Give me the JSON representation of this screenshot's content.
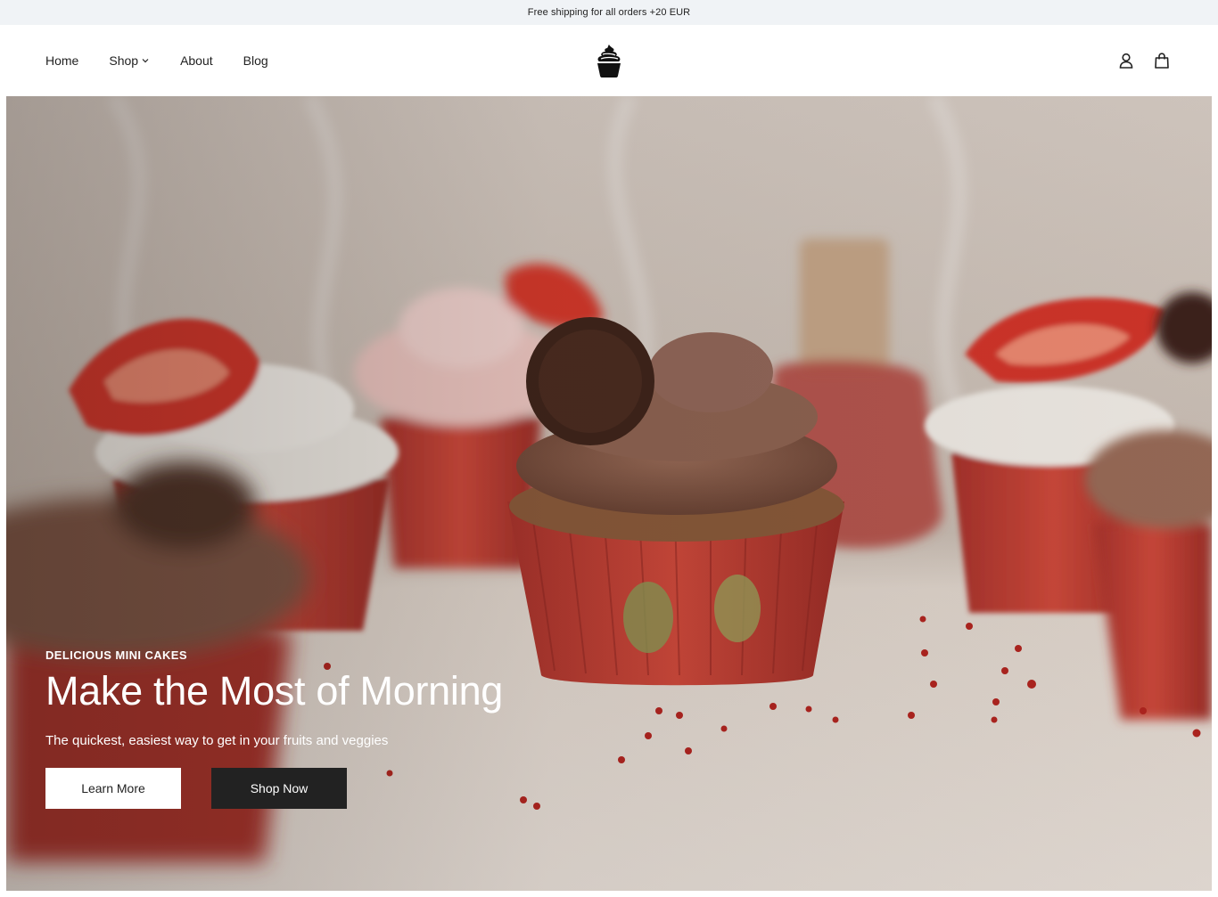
{
  "announcement": {
    "text": "Free shipping for all orders +20 EUR"
  },
  "nav": {
    "home": "Home",
    "shop": "Shop",
    "about": "About",
    "blog": "Blog"
  },
  "icons": {
    "logo": "cupcake-logo-icon",
    "account": "user-icon",
    "cart": "shopping-bag-icon",
    "shop_dropdown": "chevron-down-icon"
  },
  "hero": {
    "eyebrow": "DELICIOUS MINI CAKES",
    "title": "Make the Most of Morning",
    "subtitle": "The quickest, easiest way to get in your fruits and veggies",
    "learn_more": "Learn More",
    "shop_now": "Shop Now"
  },
  "colors": {
    "announcement_bg": "#f0f3f6",
    "button_dark": "#222222",
    "button_light": "#ffffff"
  }
}
